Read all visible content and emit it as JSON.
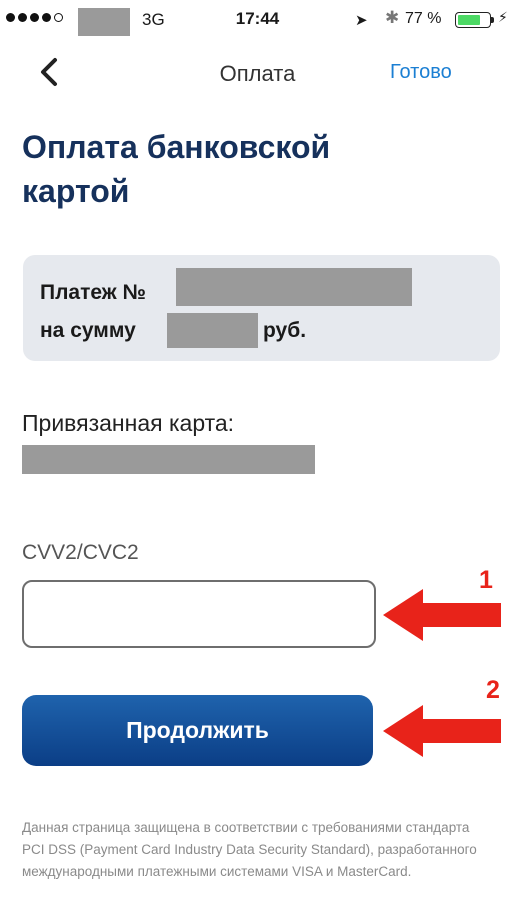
{
  "status_bar": {
    "network": "3G",
    "time": "17:44",
    "location_icon": "➤",
    "bluetooth_icon": "✱",
    "battery_text": "77 %",
    "battery_level": 0.77,
    "charging_icon": "⚡"
  },
  "nav": {
    "title": "Оплата",
    "done_label": "Готово"
  },
  "page": {
    "heading": "Оплата банковской картой"
  },
  "payment": {
    "line1_prefix": "Платеж №",
    "line2_prefix": "на сумму",
    "line2_suffix": "руб."
  },
  "linked_card": {
    "label": "Привязанная карта:"
  },
  "cvv": {
    "label": "CVV2/CVC2",
    "value": "",
    "placeholder": ""
  },
  "continue_button": {
    "label": "Продолжить"
  },
  "annotations": {
    "arrow1_number": "1",
    "arrow2_number": "2",
    "arrow_color": "#e8231a"
  },
  "footer": {
    "text": "Данная страница защищена в соответствии с требованиями стандарта PCI DSS (Payment Card Industry Data Security Standard), разработанного международными платежными системами VISA и MasterCard."
  },
  "colors": {
    "accent": "#1b7fd3",
    "heading": "#16315c",
    "button": "#0b3e86"
  }
}
